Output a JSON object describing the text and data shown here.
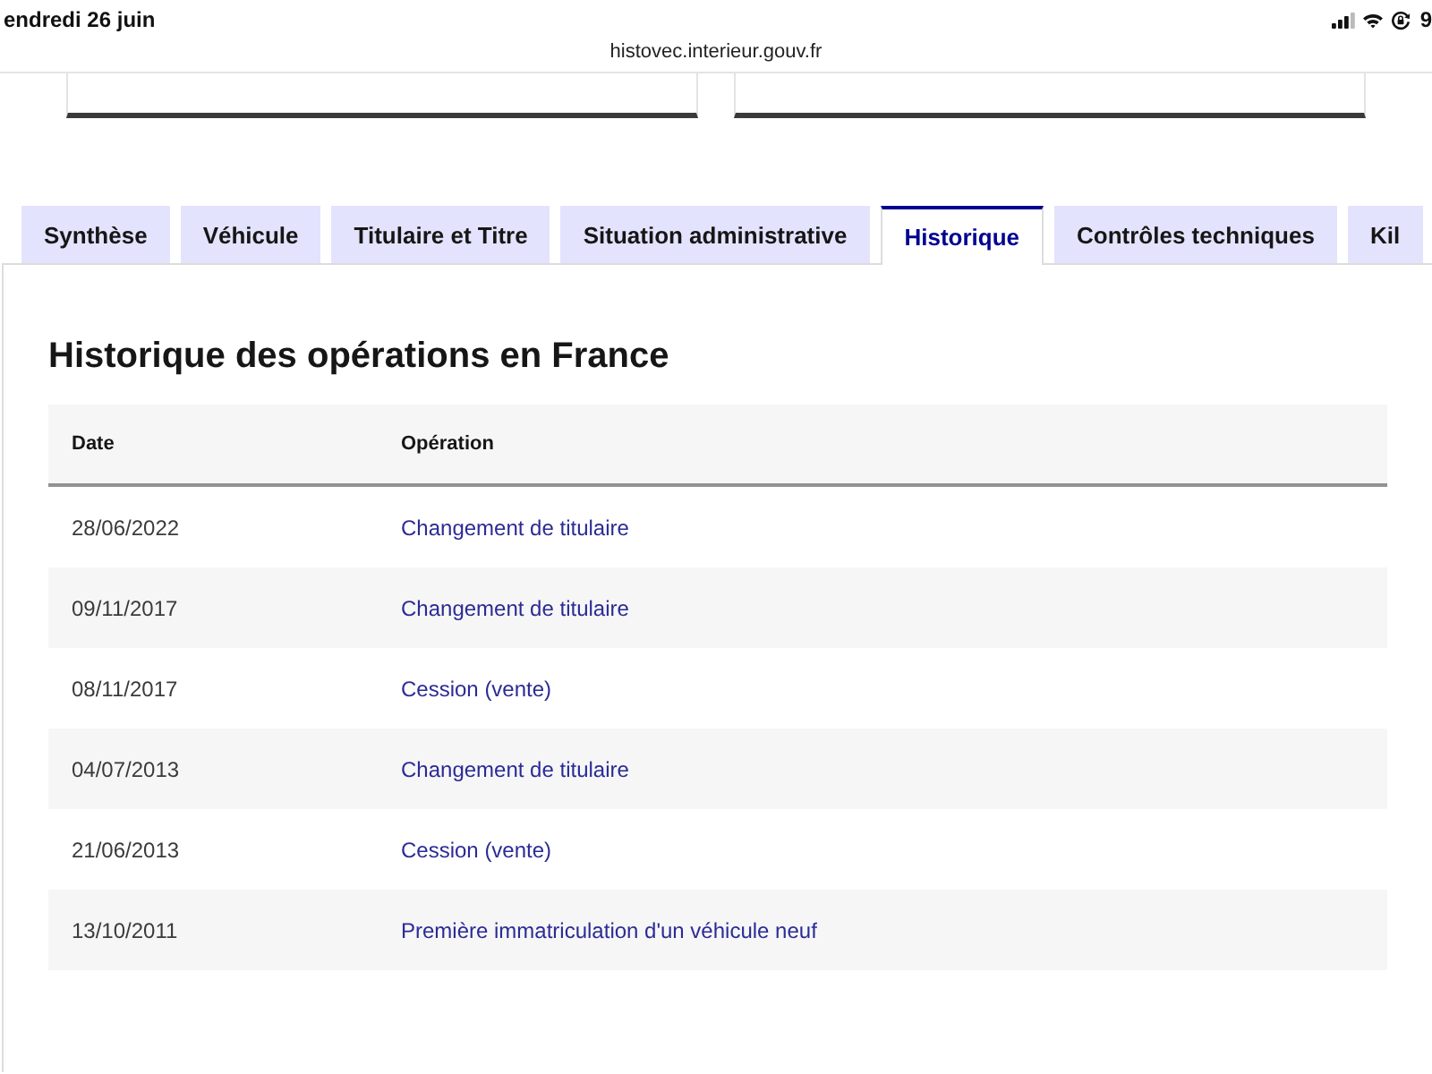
{
  "status_bar": {
    "date": "endredi 26 juin",
    "battery": "9"
  },
  "address_bar": {
    "url": "histovec.interieur.gouv.fr"
  },
  "tabs": [
    {
      "label": "Synthèse",
      "selected": false
    },
    {
      "label": "Véhicule",
      "selected": false
    },
    {
      "label": "Titulaire et Titre",
      "selected": false
    },
    {
      "label": "Situation administrative",
      "selected": false
    },
    {
      "label": "Historique",
      "selected": true
    },
    {
      "label": "Contrôles techniques",
      "selected": false
    },
    {
      "label": "Kil",
      "selected": false
    }
  ],
  "section": {
    "title": "Historique des opérations en France",
    "table": {
      "columns": [
        "Date",
        "Opération"
      ],
      "rows": [
        {
          "date": "28/06/2022",
          "operation": "Changement de titulaire"
        },
        {
          "date": "09/11/2017",
          "operation": "Changement de titulaire"
        },
        {
          "date": "08/11/2017",
          "operation": "Cession (vente)"
        },
        {
          "date": "04/07/2013",
          "operation": "Changement de titulaire"
        },
        {
          "date": "21/06/2013",
          "operation": "Cession (vente)"
        },
        {
          "date": "13/10/2011",
          "operation": "Première immatriculation d'un véhicule neuf"
        }
      ]
    }
  }
}
